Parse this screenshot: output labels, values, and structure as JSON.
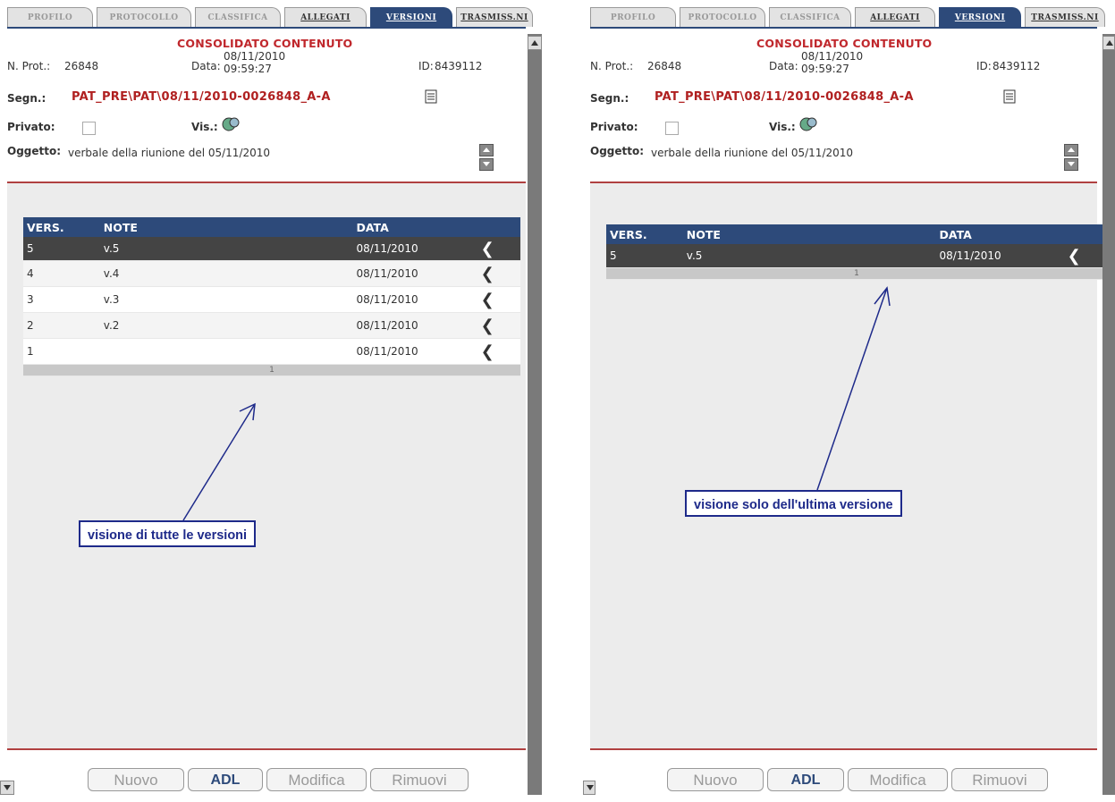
{
  "tabs": [
    {
      "label": "PROFILO",
      "state": "normal"
    },
    {
      "label": "PROTOCOLLO",
      "state": "normal"
    },
    {
      "label": "CLASSIFICA",
      "state": "normal"
    },
    {
      "label": "ALLEGATI",
      "state": "link"
    },
    {
      "label": "VERSIONI",
      "state": "active"
    },
    {
      "label": "TRASMISS.NI",
      "state": "link"
    }
  ],
  "header": {
    "banner": "CONSOLIDATO CONTENUTO",
    "prot_label": "N. Prot.:",
    "prot_value": "26848",
    "data_label": "Data:",
    "data_date": "08/11/2010",
    "data_time": "09:59:27",
    "id_label": "ID:",
    "id_value": "8439112",
    "segn_label": "Segn.:",
    "segn_value": "PAT_PRE\\PAT\\08/11/2010-0026848_A-A",
    "privato_label": "Privato:",
    "vis_label": "Vis.:",
    "oggetto_label": "Oggetto:",
    "oggetto_value": "verbale della riunione del 05/11/2010"
  },
  "table_headers": {
    "vers": "VERS.",
    "note": "NOTE",
    "data": "DATA"
  },
  "left_rows": [
    {
      "vers": "5",
      "note": "v.5",
      "data": "08/11/2010"
    },
    {
      "vers": "4",
      "note": "v.4",
      "data": "08/11/2010"
    },
    {
      "vers": "3",
      "note": "v.3",
      "data": "08/11/2010"
    },
    {
      "vers": "2",
      "note": "v.2",
      "data": "08/11/2010"
    },
    {
      "vers": "1",
      "note": "",
      "data": "08/11/2010"
    }
  ],
  "right_rows": [
    {
      "vers": "5",
      "note": "v.5",
      "data": "08/11/2010"
    }
  ],
  "pager": "1",
  "buttons": {
    "nuovo": "Nuovo",
    "adl": "ADL",
    "modifica": "Modifica",
    "rimuovi": "Rimuovi"
  },
  "callouts": {
    "left": "visione di tutte le versioni",
    "right": "visione solo dell'ultima versione"
  },
  "colors": {
    "accent": "#2d4a7a",
    "red": "#c0282d",
    "callout": "#1e2a8a"
  }
}
